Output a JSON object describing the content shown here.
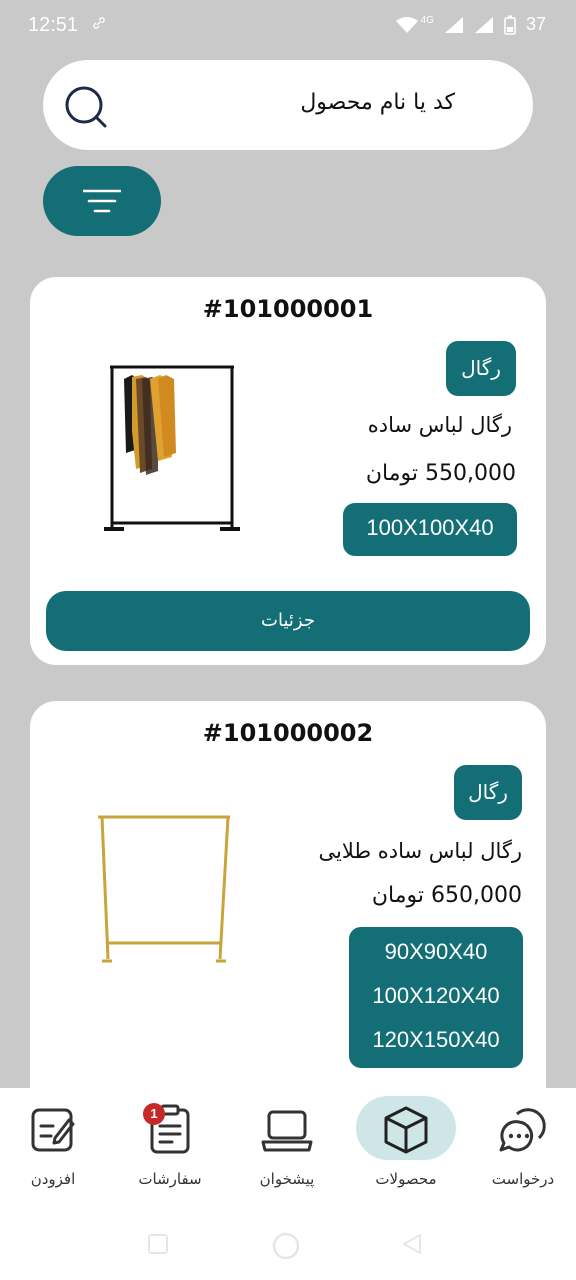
{
  "status_bar": {
    "time": "12:51",
    "network": "4G",
    "battery": "37"
  },
  "search": {
    "placeholder": "کد یا نام محصول",
    "icon": "search-icon"
  },
  "filter": {
    "icon": "filter-icon"
  },
  "products": [
    {
      "code": "#101000001",
      "category": "رگال",
      "name": "رگال لباس ساده",
      "price": "550,000 تومان",
      "sizes": [
        "100X100X40"
      ],
      "details_label": "جزئیات"
    },
    {
      "code": "#101000002",
      "category": "رگال",
      "name": "رگال لباس ساده طلایی",
      "price": "650,000 تومان",
      "sizes": [
        "90X90X40",
        "100X120X40",
        "120X150X40"
      ]
    }
  ],
  "bottom_nav": {
    "items": [
      {
        "label": "افزودن",
        "icon": "add-note-icon"
      },
      {
        "label": "سفارشات",
        "icon": "orders-icon",
        "badge": "1"
      },
      {
        "label": "پیشخوان",
        "icon": "laptop-icon"
      },
      {
        "label": "محصولات",
        "icon": "box-icon",
        "active": true
      },
      {
        "label": "درخواست",
        "icon": "chat-icon"
      }
    ]
  },
  "colors": {
    "primary": "#136e76",
    "background": "#c9c9c9",
    "active_pill": "#cfe6e8",
    "badge": "#c62828"
  }
}
